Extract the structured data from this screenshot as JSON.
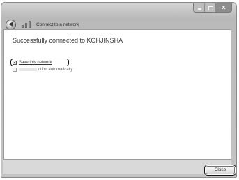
{
  "window": {
    "title": "Connect to a network",
    "controls": {
      "close_glyph": "x"
    },
    "back_glyph": "◀"
  },
  "main": {
    "heading": "Successfully connected to KOHJINSHA",
    "options": [
      {
        "label": "Save this network",
        "checked": true,
        "check_glyph": "✓"
      },
      {
        "label_visible": "ction automatically",
        "checked": false
      }
    ]
  },
  "footer": {
    "close_label": "Close"
  },
  "colors": {
    "chrome": "#c4c4c4",
    "footer": "#d9d9d9",
    "focus": "#111111"
  }
}
